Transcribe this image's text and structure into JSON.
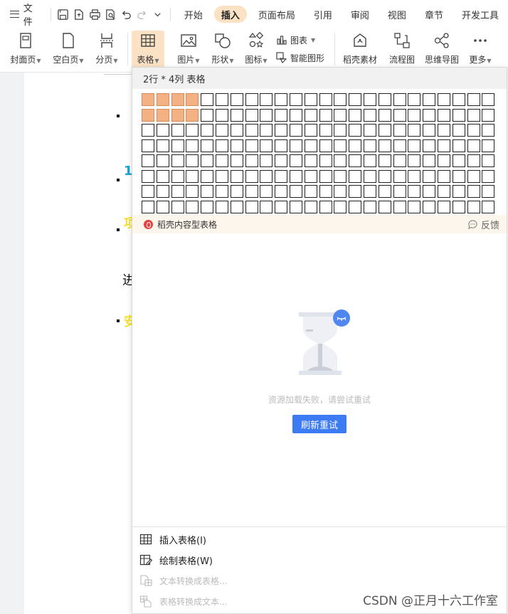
{
  "topbar": {
    "file_label": "文件",
    "quick_access_icons": [
      "save-icon",
      "export-pdf-icon",
      "print-icon",
      "print-preview-icon",
      "undo-icon",
      "redo-icon",
      "more-chevron-icon"
    ],
    "tabs": [
      {
        "label": "开始",
        "active": false
      },
      {
        "label": "插入",
        "active": true
      },
      {
        "label": "页面布局",
        "active": false
      },
      {
        "label": "引用",
        "active": false
      },
      {
        "label": "审阅",
        "active": false
      },
      {
        "label": "视图",
        "active": false
      },
      {
        "label": "章节",
        "active": false
      },
      {
        "label": "开发工具",
        "active": false
      }
    ]
  },
  "ribbon": {
    "cover_page": "封面页",
    "blank_page": "空白页",
    "page_break": "分页",
    "table": "表格",
    "picture": "图片",
    "shape": "形状",
    "icon": "图标",
    "chart": "图表",
    "smart_art": "智能图形",
    "docer_material": "稻壳素材",
    "flowchart": "流程图",
    "mind_map": "思维导图",
    "more": "更多"
  },
  "document": {
    "items": [
      "1",
      "项",
      "进",
      "安"
    ]
  },
  "table_panel": {
    "grid_label": "2行 * 4列 表格",
    "grid_rows": 8,
    "grid_cols": 24,
    "selected_rows": 2,
    "selected_cols": 4,
    "docer_label": "稻壳内容型表格",
    "feedback_label": "反馈",
    "fail_message": "资源加载失败，请尝试重试",
    "refresh_label": "刷新重试",
    "menu": [
      {
        "label": "插入表格(I)",
        "icon": "insert-table-icon",
        "enabled": true
      },
      {
        "label": "绘制表格(W)",
        "icon": "draw-table-icon",
        "enabled": true
      },
      {
        "label": "文本转换成表格...",
        "icon": "text-to-table-icon",
        "enabled": false
      },
      {
        "label": "表格转换成文本...",
        "icon": "table-to-text-icon",
        "enabled": false
      }
    ]
  },
  "colors": {
    "accent": "#3d7bf5",
    "tab_active_bg": "#fbe2c4",
    "selected_cell": "#f4b183"
  },
  "watermark": "CSDN @正月十六工作室"
}
